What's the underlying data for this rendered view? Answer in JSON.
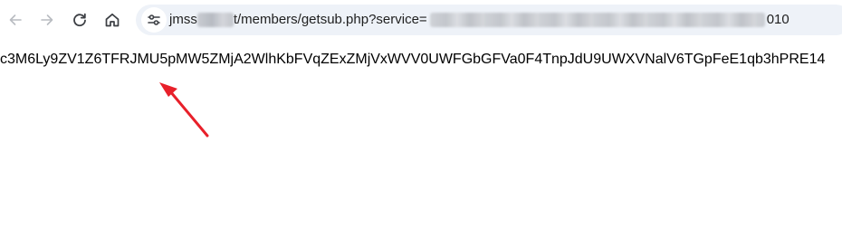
{
  "browser": {
    "url": {
      "visible_prefix": "jmss",
      "visible_middle": "t/members/getsub.php?service=",
      "visible_suffix": "010"
    },
    "icons": {
      "back": "arrow-left-icon",
      "forward": "arrow-right-icon",
      "reload": "reload-icon",
      "home": "home-icon",
      "site_info": "tune-icon"
    }
  },
  "page": {
    "body_text": "c3M6Ly9ZV1Z6TFRJMU5pMW5ZMjA2WlhKbFVqZExZMjVxWVV0UWFGbGFVa0F4TnpJdU9UWXVNalV6TGpFeE1qb3hPRE14"
  },
  "annotation": {
    "arrow_color": "#e8202a"
  }
}
